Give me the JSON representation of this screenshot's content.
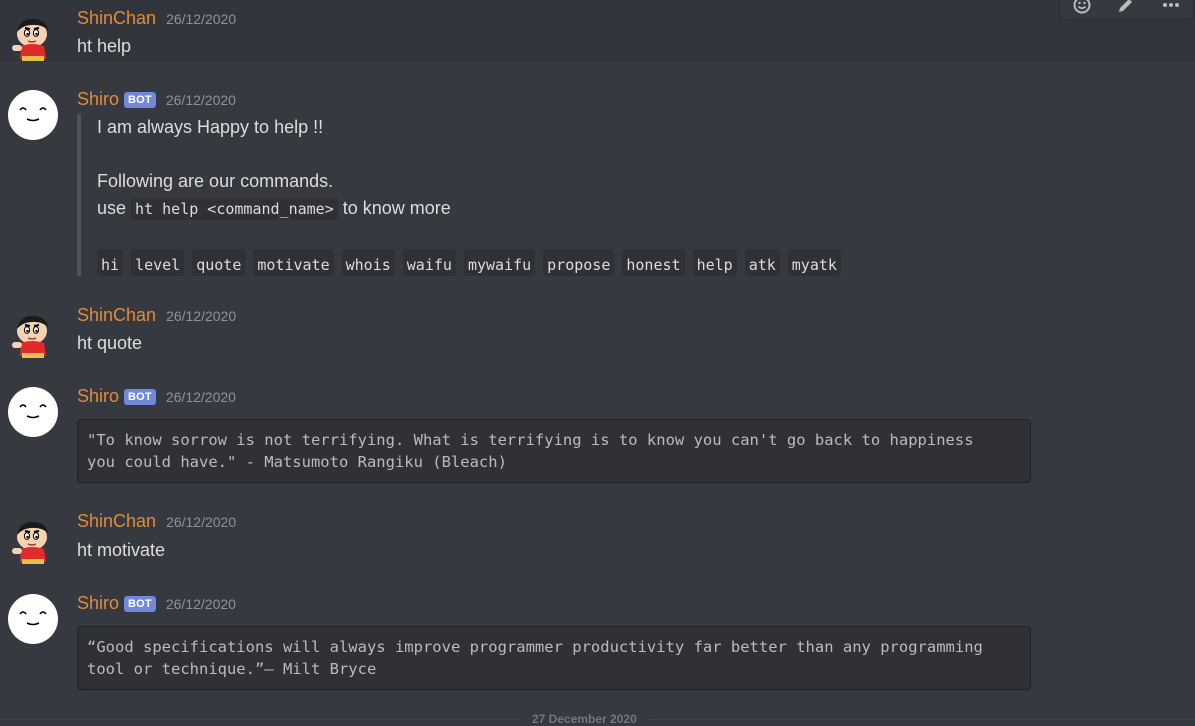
{
  "toolbar": {
    "icons": [
      "add-reaction-icon",
      "edit-icon",
      "more-icon"
    ]
  },
  "messages": [
    {
      "author": "ShinChan",
      "timestamp": "26/12/2020",
      "text": "ht help"
    },
    {
      "author": "Shiro",
      "bot_tag": "BOT",
      "timestamp": "26/12/2020",
      "embed": {
        "line1": "I am always Happy to help !!",
        "line2": "Following are our commands.",
        "line3_prefix": "use",
        "line3_code": "ht help <command_name>",
        "line3_suffix": "to know more",
        "commands": [
          "hi",
          "level",
          "quote",
          "motivate",
          "whois",
          "waifu",
          "mywaifu",
          "propose",
          "honest",
          "help",
          "atk",
          "myatk"
        ]
      }
    },
    {
      "author": "ShinChan",
      "timestamp": "26/12/2020",
      "text": "ht quote"
    },
    {
      "author": "Shiro",
      "bot_tag": "BOT",
      "timestamp": "26/12/2020",
      "code": "\"To know sorrow is not terrifying. What is terrifying is to know you can't go back to happiness\nyou could have.\" - Matsumoto Rangiku (Bleach)"
    },
    {
      "author": "ShinChan",
      "timestamp": "26/12/2020",
      "text": "ht motivate"
    },
    {
      "author": "Shiro",
      "bot_tag": "BOT",
      "timestamp": "26/12/2020",
      "code": "“Good specifications will always improve programmer productivity far better than any programming\ntool or technique.”– Milt Bryce"
    }
  ],
  "divider": {
    "label": "27 December 2020"
  },
  "colors": {
    "author": "#e38b38",
    "bot_tag": "#7289da",
    "background": "#36393f"
  }
}
